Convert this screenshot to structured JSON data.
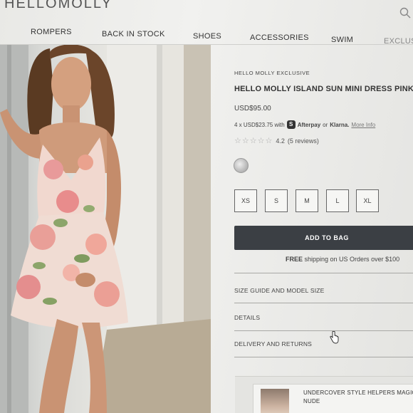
{
  "header": {
    "logo": "HELLOMOLLY",
    "search_icon": "search-icon"
  },
  "nav": {
    "items": [
      {
        "label": "ROMPERS"
      },
      {
        "label": "BACK IN STOCK"
      },
      {
        "label": "SHOES"
      },
      {
        "label": "ACCESSORIES"
      },
      {
        "label": "SWIM"
      },
      {
        "label": "EXCLUSI"
      }
    ]
  },
  "product": {
    "brand": "HELLO MOLLY EXCLUSIVE",
    "title": "HELLO MOLLY ISLAND SUN MINI DRESS PINK",
    "price": "USD$95.00",
    "installment_prefix": "4 x USD$23.75 with",
    "afterpay_glyph": "S",
    "afterpay_label": "Afterpay",
    "or_label": "or",
    "klarna_label": "Klarna.",
    "more_info": "More Info",
    "rating_value": "4.2",
    "rating_stars": 4.2,
    "review_count": "(5 reviews)",
    "stars_glyph": "☆☆☆☆☆",
    "sizes": [
      "XS",
      "S",
      "M",
      "L",
      "XL"
    ],
    "add_to_bag": "ADD TO BAG",
    "shipping_bold": "FREE",
    "shipping_rest": " shipping on US Orders over $100"
  },
  "accordion": {
    "size_guide": "SIZE GUIDE AND MODEL SIZE",
    "details": "DETAILS",
    "delivery": "DELIVERY AND RETURNS"
  },
  "helper": {
    "title": "UNDERCOVER STYLE HELPERS MAGIC NUDE"
  },
  "colors": {
    "button_bg": "#3b3f44",
    "dress_pink": "#e89a9a",
    "leaf_green": "#8ca56a"
  }
}
